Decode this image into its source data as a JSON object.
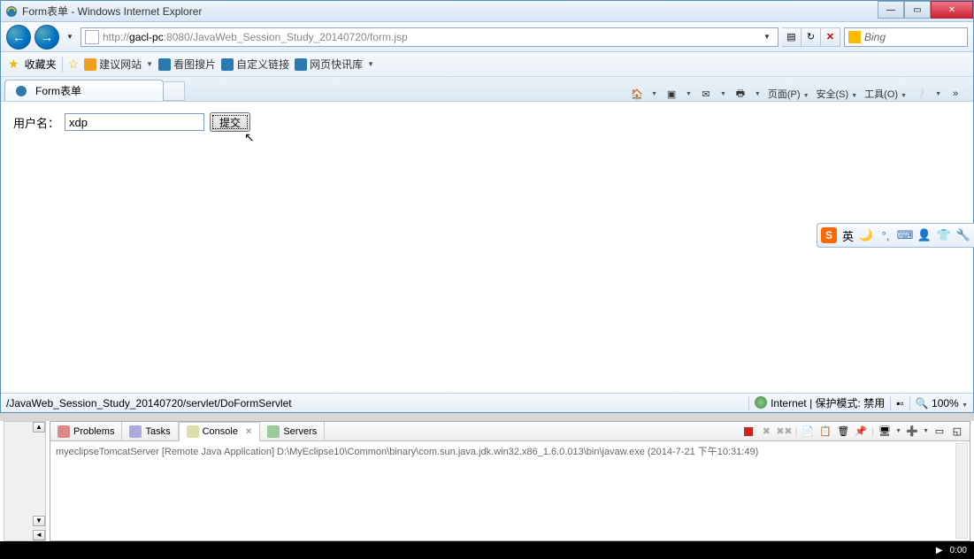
{
  "window": {
    "title": "Form表单 - Windows Internet Explorer"
  },
  "nav": {
    "url_prefix": "http://",
    "url_host": "gacl-pc",
    "url_suffix": ":8080/JavaWeb_Session_Study_20140720/form.jsp",
    "search_engine": "Bing"
  },
  "favorites": {
    "label": "收藏夹",
    "items": [
      "建议网站",
      "看图搜片",
      "自定义链接",
      "网页快讯库"
    ]
  },
  "tabs": {
    "active": "Form表单"
  },
  "command_bar": {
    "page": "页面(P)",
    "safety": "安全(S)",
    "tools": "工具(O)"
  },
  "form": {
    "label": "用户名：",
    "value": "xdp",
    "submit": "提交"
  },
  "status": {
    "left": "/JavaWeb_Session_Study_20140720/servlet/DoFormServlet",
    "zone": "Internet | 保护模式: 禁用",
    "zoom": "100%"
  },
  "ime": {
    "logo": "S",
    "lang": "英"
  },
  "eclipse": {
    "tabs": {
      "problems": "Problems",
      "tasks": "Tasks",
      "console": "Console",
      "servers": "Servers"
    },
    "console_line": "myeclipseTomcatServer [Remote Java Application] D:\\MyEclipse10\\Common\\binary\\com.sun.java.jdk.win32.x86_1.6.0.013\\bin\\javaw.exe (2014-7-21 下午10:31:49)"
  },
  "taskbar": {
    "time": "0:00"
  }
}
